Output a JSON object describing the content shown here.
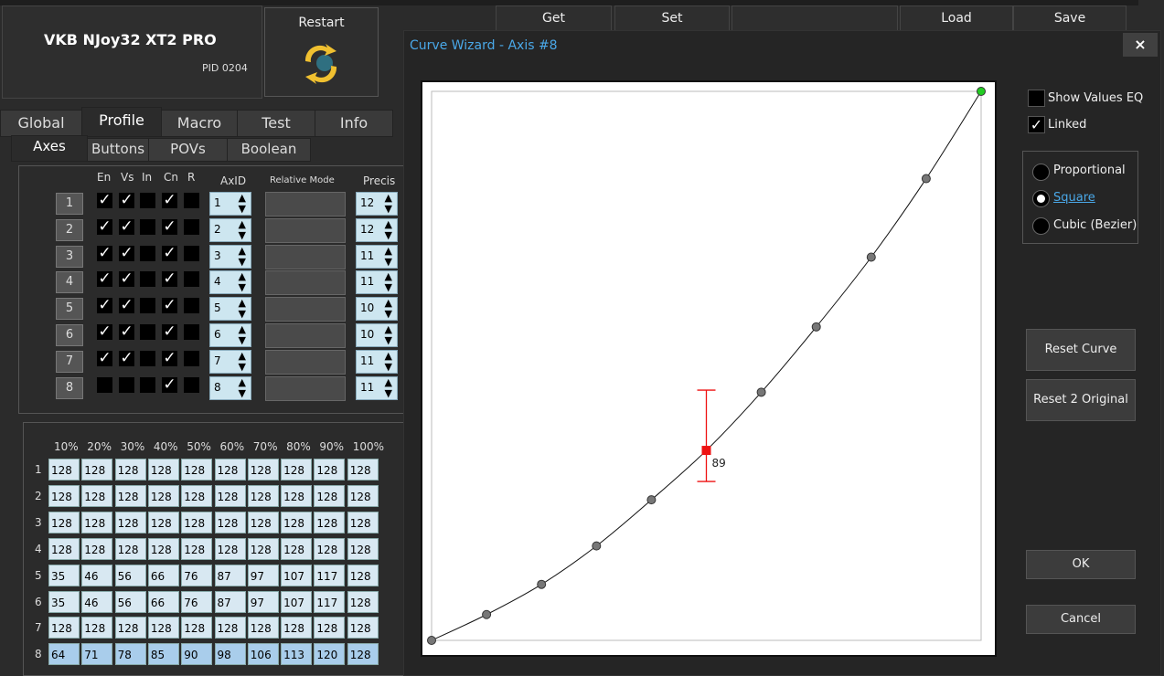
{
  "device": {
    "name": "VKB NJoy32 XT2 PRO",
    "pid": "PID 0204",
    "restart_label": "Restart"
  },
  "toolbar": {
    "get": "Get",
    "set": "Set",
    "load": "Load",
    "save": "Save"
  },
  "tabs": [
    "Global",
    "Profile",
    "Macro",
    "Test",
    "Info"
  ],
  "active_tab": "Profile",
  "subtabs": [
    "Axes",
    "Buttons",
    "POVs",
    "Boolean"
  ],
  "active_subtab": "Axes",
  "axes_table": {
    "headers": {
      "en": "En",
      "vs": "Vs",
      "in": "In",
      "cn": "Cn",
      "r": "R",
      "axid": "AxID",
      "relative": "Relative Mode",
      "precis": "Precis"
    },
    "rows": [
      {
        "num": "1",
        "en": true,
        "vs": true,
        "in": false,
        "cn": true,
        "r": false,
        "axid": "1",
        "precis": "12"
      },
      {
        "num": "2",
        "en": true,
        "vs": true,
        "in": false,
        "cn": true,
        "r": false,
        "axid": "2",
        "precis": "12"
      },
      {
        "num": "3",
        "en": true,
        "vs": true,
        "in": false,
        "cn": true,
        "r": false,
        "axid": "3",
        "precis": "11"
      },
      {
        "num": "4",
        "en": true,
        "vs": true,
        "in": false,
        "cn": true,
        "r": false,
        "axid": "4",
        "precis": "11"
      },
      {
        "num": "5",
        "en": true,
        "vs": true,
        "in": false,
        "cn": true,
        "r": false,
        "axid": "5",
        "precis": "10"
      },
      {
        "num": "6",
        "en": true,
        "vs": true,
        "in": false,
        "cn": true,
        "r": false,
        "axid": "6",
        "precis": "10"
      },
      {
        "num": "7",
        "en": true,
        "vs": true,
        "in": false,
        "cn": true,
        "r": false,
        "axid": "7",
        "precis": "11"
      },
      {
        "num": "8",
        "en": false,
        "vs": false,
        "in": false,
        "cn": true,
        "r": false,
        "axid": "8",
        "precis": "11"
      }
    ]
  },
  "curve_table": {
    "headers": [
      "10%",
      "20%",
      "30%",
      "40%",
      "50%",
      "60%",
      "70%",
      "80%",
      "90%",
      "100%"
    ],
    "rows": [
      {
        "idx": "1",
        "values": [
          "128",
          "128",
          "128",
          "128",
          "128",
          "128",
          "128",
          "128",
          "128",
          "128"
        ]
      },
      {
        "idx": "2",
        "values": [
          "128",
          "128",
          "128",
          "128",
          "128",
          "128",
          "128",
          "128",
          "128",
          "128"
        ]
      },
      {
        "idx": "3",
        "values": [
          "128",
          "128",
          "128",
          "128",
          "128",
          "128",
          "128",
          "128",
          "128",
          "128"
        ]
      },
      {
        "idx": "4",
        "values": [
          "128",
          "128",
          "128",
          "128",
          "128",
          "128",
          "128",
          "128",
          "128",
          "128"
        ]
      },
      {
        "idx": "5",
        "values": [
          "35",
          "46",
          "56",
          "66",
          "76",
          "87",
          "97",
          "107",
          "117",
          "128"
        ]
      },
      {
        "idx": "6",
        "values": [
          "35",
          "46",
          "56",
          "66",
          "76",
          "87",
          "97",
          "107",
          "117",
          "128"
        ]
      },
      {
        "idx": "7",
        "values": [
          "128",
          "128",
          "128",
          "128",
          "128",
          "128",
          "128",
          "128",
          "128",
          "128"
        ]
      },
      {
        "idx": "8",
        "values": [
          "64",
          "71",
          "78",
          "85",
          "90",
          "98",
          "106",
          "113",
          "120",
          "128"
        ]
      }
    ]
  },
  "dialog": {
    "title": "Curve Wizard - Axis #8",
    "close": "×",
    "show_values_label": "Show Values EQ",
    "show_values_checked": false,
    "linked_label": "Linked",
    "linked_checked": true,
    "modes": [
      "Proportional",
      "Square",
      "Cubic (Bezier)"
    ],
    "selected_mode": "Square",
    "reset_curve": "Reset Curve",
    "reset_original": "Reset 2 Original",
    "ok": "OK",
    "cancel": "Cancel",
    "point_value_label": "89",
    "colors": {
      "curve": "#111111",
      "point": "#777777",
      "endpoint": "#22cc22",
      "selected": "#ee1111"
    }
  },
  "chart_data": {
    "type": "line",
    "x": [
      0,
      10,
      20,
      30,
      40,
      50,
      60,
      70,
      80,
      90,
      100
    ],
    "y": [
      0,
      4.7,
      10.2,
      17.2,
      25.6,
      34.6,
      45.2,
      57.1,
      69.8,
      84.1,
      100
    ],
    "selected_index": 5,
    "selected_label": "89",
    "xlim": [
      0,
      100
    ],
    "ylim": [
      0,
      100
    ]
  }
}
